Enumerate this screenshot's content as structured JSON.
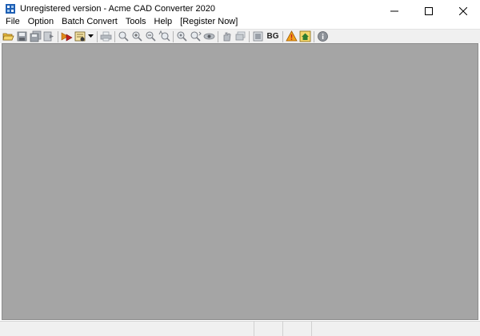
{
  "window": {
    "title": "Unregistered version - Acme CAD Converter 2020"
  },
  "menu": {
    "items": [
      {
        "id": "file",
        "label": "File"
      },
      {
        "id": "option",
        "label": "Option"
      },
      {
        "id": "batch-convert",
        "label": "Batch Convert"
      },
      {
        "id": "tools",
        "label": "Tools"
      },
      {
        "id": "help",
        "label": "Help"
      },
      {
        "id": "register-now",
        "label": "[Register Now]"
      }
    ]
  },
  "toolbar": {
    "bg_label": "BG",
    "icons": [
      "open-folder-icon",
      "save-icon",
      "save-all-icon",
      "export-icon",
      "convert-icon",
      "properties-icon",
      "dropdown-arrow-icon",
      "print-icon",
      "zoom-window-icon",
      "zoom-in-icon",
      "zoom-out-icon",
      "zoom-extents-icon",
      "zoom-realtime-icon",
      "zoom-previous-icon",
      "view-icon",
      "pan-icon",
      "layers-icon",
      "raster-icon",
      "background-toggle",
      "warning-icon",
      "home-icon",
      "info-icon"
    ]
  },
  "colors": {
    "canvas": "#a5a5a5",
    "toolbar": "#f0f0f0",
    "app_icon_blue": "#1e5fb4",
    "accent_orange": "#e08a1c",
    "accent_red": "#c02020"
  }
}
